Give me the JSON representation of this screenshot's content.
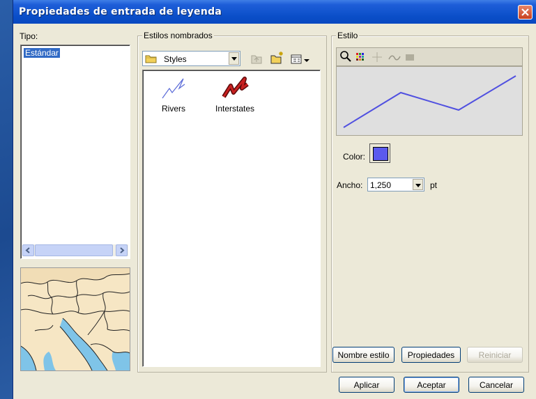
{
  "window": {
    "title": "Propiedades de entrada de leyenda"
  },
  "tipo": {
    "label": "Tipo:",
    "items": [
      "Estándar"
    ],
    "selected": 0
  },
  "estilos": {
    "label": "Estilos nombrados",
    "folder": "Styles",
    "items": [
      {
        "label": "Rivers",
        "icon": "rivers-line-icon",
        "color": "#5a6ad8"
      },
      {
        "label": "Interstates",
        "icon": "interstates-line-icon",
        "color": "#b81818"
      }
    ]
  },
  "estilo": {
    "label": "Estilo",
    "tools": [
      "zoom-icon",
      "palette-icon",
      "crosshair-icon",
      "line-style-icon",
      "fill-icon"
    ],
    "color_label": "Color:",
    "color_value": "#5a5aee",
    "ancho_label": "Ancho:",
    "ancho_value": "1,250",
    "ancho_unit": "pt",
    "buttons": {
      "nombre": "Nombre estilo",
      "propiedades": "Propiedades",
      "reiniciar": "Reiniciar"
    }
  },
  "footer": {
    "aplicar": "Aplicar",
    "aceptar": "Aceptar",
    "cancelar": "Cancelar"
  },
  "colors": {
    "title_bar": "#0a4ec8",
    "dialog_bg": "#ece9d8",
    "preview_line": "#5050e0",
    "selection": "#316ac5"
  }
}
